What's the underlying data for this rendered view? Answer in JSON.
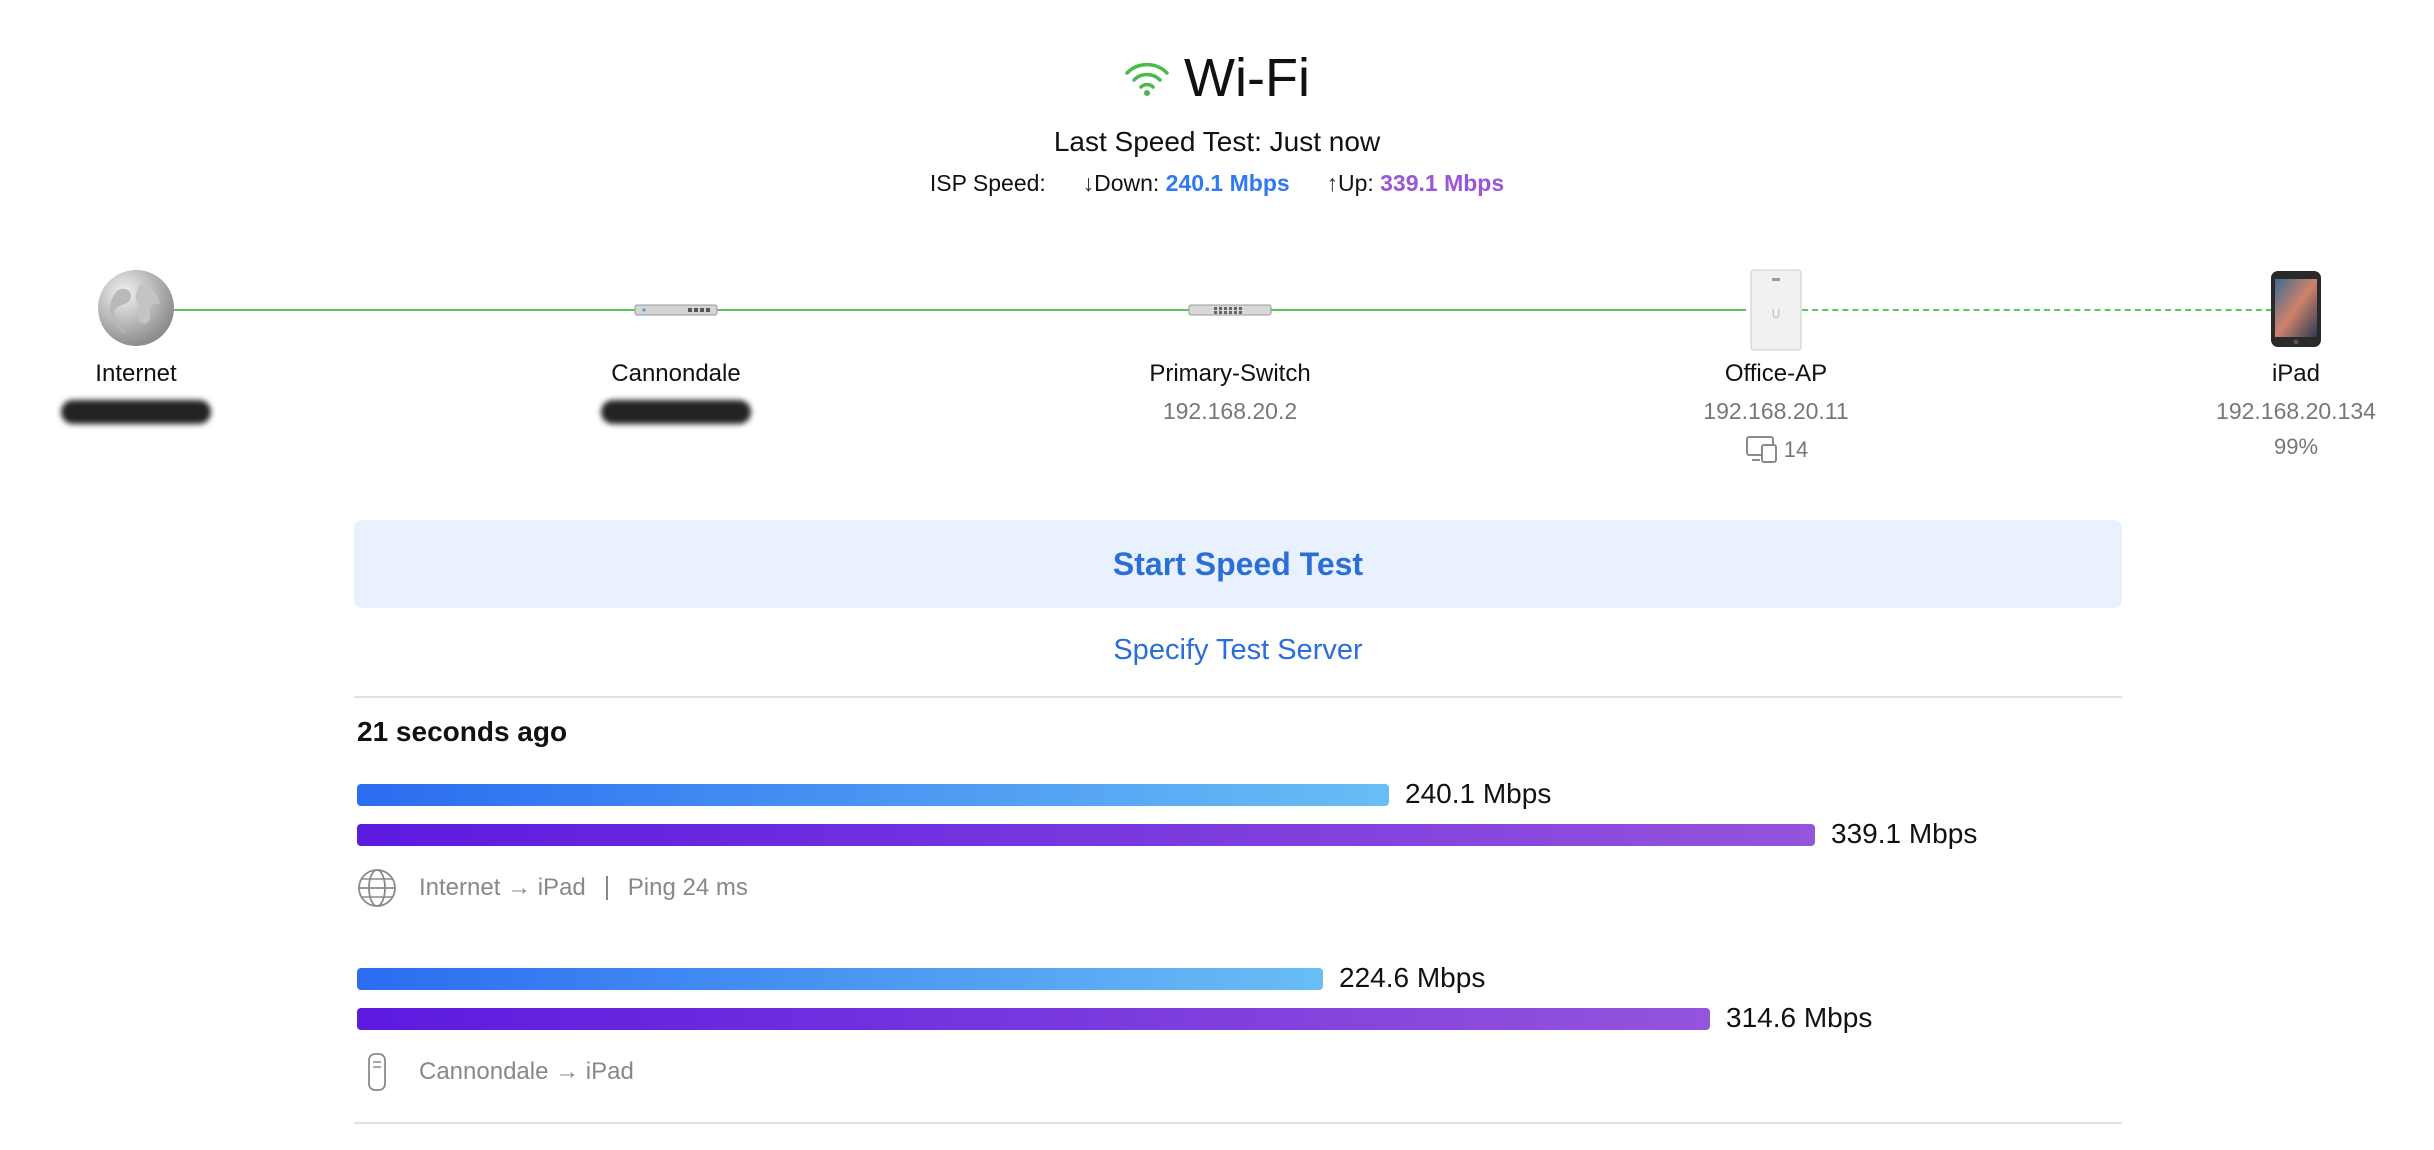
{
  "header": {
    "title": "Wi-Fi",
    "last_speed_test": "Last Speed Test: Just now",
    "isp_label": "ISP Speed:",
    "down_label": "Down:",
    "down_value": "240.1 Mbps",
    "up_label": "Up:",
    "up_value": "339.1 Mbps",
    "colors": {
      "wifi": "#4cb94c",
      "down": "#2f7af0",
      "up": "#9a55d8"
    }
  },
  "topology": {
    "nodes": [
      {
        "name": "Internet",
        "ip": "",
        "icon": "globe-icon"
      },
      {
        "name": "Cannondale",
        "ip": "",
        "icon": "gateway-device-icon"
      },
      {
        "name": "Primary-Switch",
        "ip": "192.168.20.2",
        "icon": "switch-device-icon"
      },
      {
        "name": "Office-AP",
        "ip": "192.168.20.11",
        "icon": "access-point-icon",
        "clients": "14"
      },
      {
        "name": "iPad",
        "ip": "192.168.20.134",
        "icon": "tablet-icon",
        "signal": "99%"
      }
    ],
    "link_color": "#5bc45b"
  },
  "actions": {
    "start_speed_test": "Start Speed Test",
    "specify_test_server": "Specify Test Server"
  },
  "results": [
    {
      "time": "21 seconds ago",
      "tests": [
        {
          "down": "240.1 Mbps",
          "up": "339.1 Mbps",
          "down_value": 240.1,
          "up_value": 339.1,
          "path": "Internet → iPad",
          "ping": "Ping 24 ms",
          "icon": "globe-icon"
        },
        {
          "down": "224.6 Mbps",
          "up": "314.6 Mbps",
          "down_value": 224.6,
          "up_value": 314.6,
          "path": "Cannondale → iPad",
          "icon": "gateway-device-icon"
        }
      ]
    }
  ]
}
